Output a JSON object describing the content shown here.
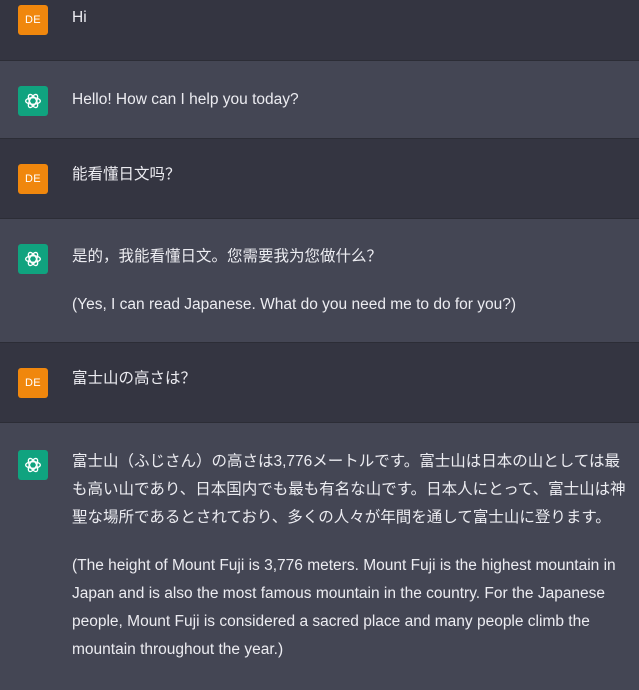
{
  "user_avatar_initials": "DE",
  "messages": [
    {
      "role": "user",
      "paragraphs": [
        "Hi"
      ]
    },
    {
      "role": "assistant",
      "paragraphs": [
        "Hello! How can I help you today?"
      ]
    },
    {
      "role": "user",
      "paragraphs": [
        "能看懂日文吗？"
      ]
    },
    {
      "role": "assistant",
      "paragraphs": [
        "是的，我能看懂日文。您需要我为您做什么？",
        "(Yes, I can read Japanese. What do you need me to do for you?)"
      ]
    },
    {
      "role": "user",
      "paragraphs": [
        "富士山の高さは？"
      ]
    },
    {
      "role": "assistant",
      "paragraphs": [
        "富士山（ふじさん）の高さは3,776メートルです。富士山は日本の山としては最も高い山であり、日本国内でも最も有名な山です。日本人にとって、富士山は神聖な場所であるとされており、多くの人々が年間を通して富士山に登ります。",
        "(The height of Mount Fuji is 3,776 meters. Mount Fuji is the highest mountain in Japan and is also the most famous mountain in the country. For the Japanese people, Mount Fuji is considered a sacred place and many people climb the mountain throughout the year.)"
      ]
    }
  ],
  "colors": {
    "user_row_bg": "#343541",
    "assistant_row_bg": "#444654",
    "user_avatar_bg": "#f0870d",
    "assistant_avatar_bg": "#10a37f",
    "text": "#ececf1"
  },
  "icons": {
    "assistant_avatar": "openai-logo-icon"
  }
}
